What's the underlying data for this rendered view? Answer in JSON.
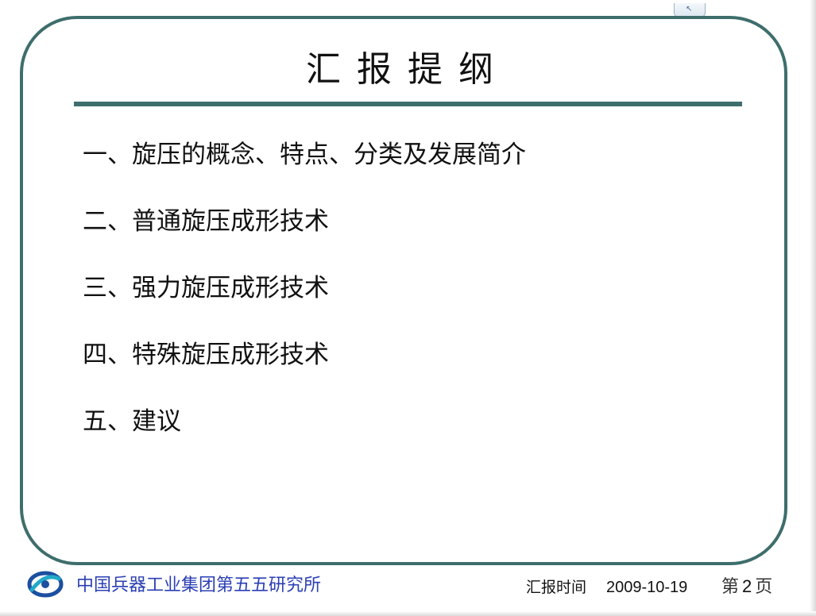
{
  "slide": {
    "title": "汇报提纲",
    "outline": [
      "一、旋压的概念、特点、分类及发展简介",
      "二、普通旋压成形技术",
      "三、强力旋压成形技术",
      "四、特殊旋压成形技术",
      "五、建议"
    ]
  },
  "footer": {
    "organization": "中国兵器工业集团第五五研究所",
    "report_time_label": "汇报时间",
    "report_date": "2009-10-19",
    "page_prefix": "第",
    "page_number": "2",
    "page_suffix": "页"
  },
  "icons": {
    "logo": "organization-logo-icon",
    "tab": "restore-tab-icon"
  },
  "colors": {
    "frame": "#3e6e6c",
    "organization_text": "#2b3fb5",
    "logo_blue": "#1c4fa0",
    "logo_cyan": "#22a9c8"
  }
}
